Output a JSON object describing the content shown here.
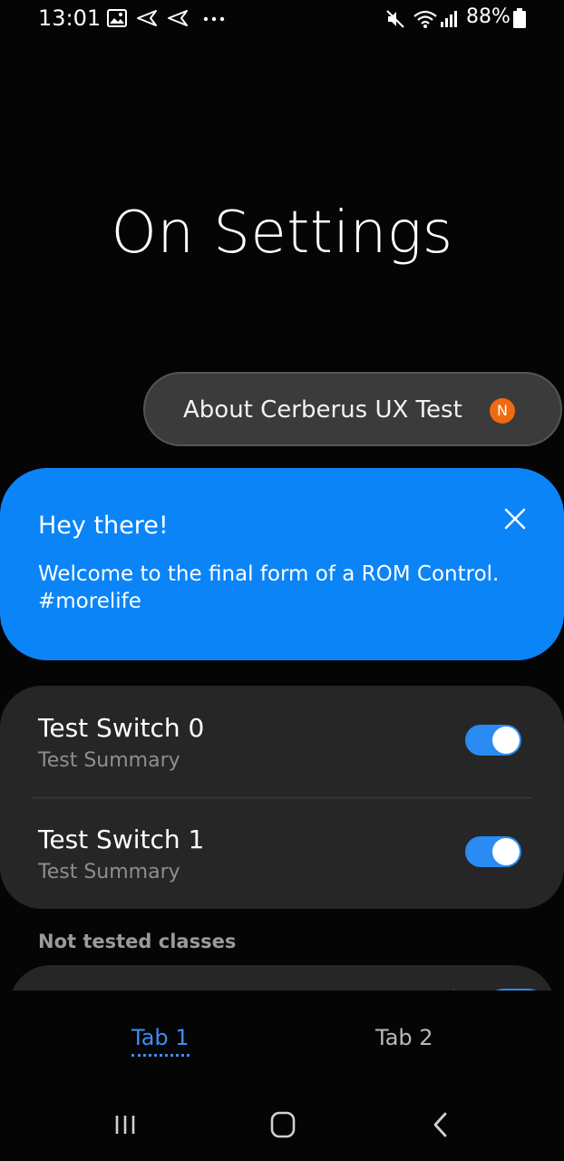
{
  "status_bar": {
    "time": "13:01",
    "battery_percent": "88%",
    "icons": [
      "image-icon",
      "send-icon",
      "send-icon",
      "more-dots-icon",
      "mute-icon",
      "wifi-icon",
      "signal-icon",
      "battery-icon"
    ]
  },
  "page": {
    "title": "On Settings"
  },
  "about": {
    "label": "About Cerberus UX Test",
    "badge": "N",
    "badge_color": "#f06a10"
  },
  "welcome_card": {
    "title": "Hey there!",
    "body": "Welcome to the final form of a ROM Control. #morelife",
    "background": "#0b84f8"
  },
  "switches": [
    {
      "title": "Test Switch 0",
      "summary": "Test Summary",
      "checked": true
    },
    {
      "title": "Test Switch 1",
      "summary": "Test Summary",
      "checked": true
    }
  ],
  "section": {
    "header": "Not tested classes"
  },
  "tabs": [
    {
      "label": "Tab 1",
      "selected": true
    },
    {
      "label": "Tab 2",
      "selected": false
    }
  ],
  "nav_bar": {
    "buttons": [
      "recents-icon",
      "home-icon",
      "back-icon"
    ]
  },
  "colors": {
    "accent": "#3d8ef2",
    "toggle_on": "#2a8bf2",
    "card": "#262626",
    "background": "#050505"
  }
}
